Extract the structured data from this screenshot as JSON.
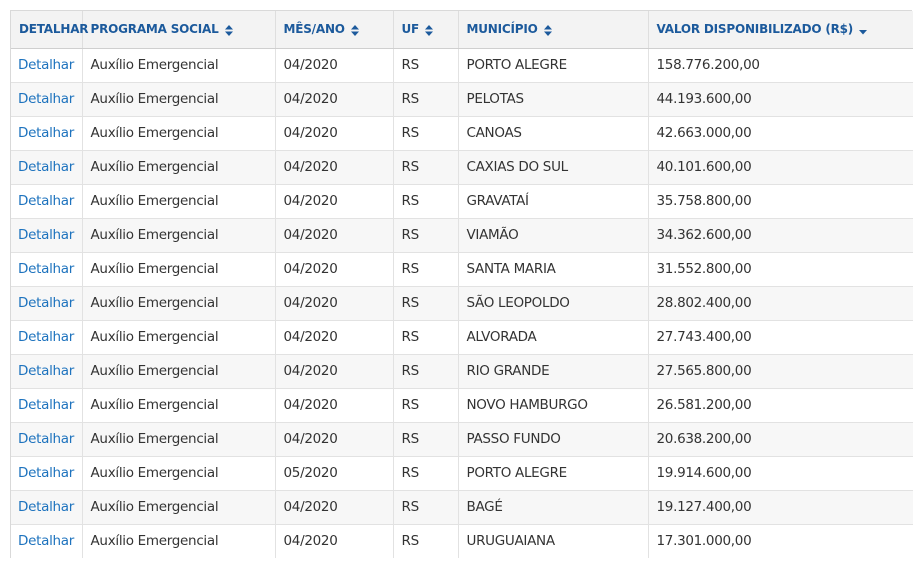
{
  "table": {
    "headers": [
      {
        "label": "DETALHAR",
        "sort": "none"
      },
      {
        "label": "PROGRAMA SOCIAL",
        "sort": "both"
      },
      {
        "label": "MÊS/ANO",
        "sort": "both"
      },
      {
        "label": "UF",
        "sort": "both"
      },
      {
        "label": "MUNICÍPIO",
        "sort": "both"
      },
      {
        "label": "VALOR DISPONIBILIZADO (R$)",
        "sort": "desc"
      }
    ],
    "rows": [
      {
        "detalhar": "Detalhar",
        "programa": "Auxílio Emergencial",
        "mes_ano": "04/2020",
        "uf": "RS",
        "municipio": "PORTO ALEGRE",
        "valor": "158.776.200,00"
      },
      {
        "detalhar": "Detalhar",
        "programa": "Auxílio Emergencial",
        "mes_ano": "04/2020",
        "uf": "RS",
        "municipio": "PELOTAS",
        "valor": "44.193.600,00"
      },
      {
        "detalhar": "Detalhar",
        "programa": "Auxílio Emergencial",
        "mes_ano": "04/2020",
        "uf": "RS",
        "municipio": "CANOAS",
        "valor": "42.663.000,00"
      },
      {
        "detalhar": "Detalhar",
        "programa": "Auxílio Emergencial",
        "mes_ano": "04/2020",
        "uf": "RS",
        "municipio": "CAXIAS DO SUL",
        "valor": "40.101.600,00"
      },
      {
        "detalhar": "Detalhar",
        "programa": "Auxílio Emergencial",
        "mes_ano": "04/2020",
        "uf": "RS",
        "municipio": "GRAVATAÍ",
        "valor": "35.758.800,00"
      },
      {
        "detalhar": "Detalhar",
        "programa": "Auxílio Emergencial",
        "mes_ano": "04/2020",
        "uf": "RS",
        "municipio": "VIAMÃO",
        "valor": "34.362.600,00"
      },
      {
        "detalhar": "Detalhar",
        "programa": "Auxílio Emergencial",
        "mes_ano": "04/2020",
        "uf": "RS",
        "municipio": "SANTA MARIA",
        "valor": "31.552.800,00"
      },
      {
        "detalhar": "Detalhar",
        "programa": "Auxílio Emergencial",
        "mes_ano": "04/2020",
        "uf": "RS",
        "municipio": "SÃO LEOPOLDO",
        "valor": "28.802.400,00"
      },
      {
        "detalhar": "Detalhar",
        "programa": "Auxílio Emergencial",
        "mes_ano": "04/2020",
        "uf": "RS",
        "municipio": "ALVORADA",
        "valor": "27.743.400,00"
      },
      {
        "detalhar": "Detalhar",
        "programa": "Auxílio Emergencial",
        "mes_ano": "04/2020",
        "uf": "RS",
        "municipio": "RIO GRANDE",
        "valor": "27.565.800,00"
      },
      {
        "detalhar": "Detalhar",
        "programa": "Auxílio Emergencial",
        "mes_ano": "04/2020",
        "uf": "RS",
        "municipio": "NOVO HAMBURGO",
        "valor": "26.581.200,00"
      },
      {
        "detalhar": "Detalhar",
        "programa": "Auxílio Emergencial",
        "mes_ano": "04/2020",
        "uf": "RS",
        "municipio": "PASSO FUNDO",
        "valor": "20.638.200,00"
      },
      {
        "detalhar": "Detalhar",
        "programa": "Auxílio Emergencial",
        "mes_ano": "05/2020",
        "uf": "RS",
        "municipio": "PORTO ALEGRE",
        "valor": "19.914.600,00"
      },
      {
        "detalhar": "Detalhar",
        "programa": "Auxílio Emergencial",
        "mes_ano": "04/2020",
        "uf": "RS",
        "municipio": "BAGÉ",
        "valor": "19.127.400,00"
      },
      {
        "detalhar": "Detalhar",
        "programa": "Auxílio Emergencial",
        "mes_ano": "04/2020",
        "uf": "RS",
        "municipio": "URUGUAIANA",
        "valor": "17.301.000,00"
      }
    ]
  },
  "colors": {
    "header_text": "#1c5a9c",
    "link": "#1e73be",
    "header_bg": "#f3f3f3",
    "row_alt_bg": "#f7f7f7"
  }
}
